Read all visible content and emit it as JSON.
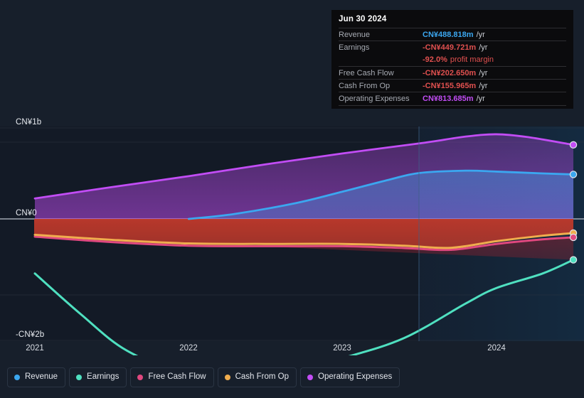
{
  "chart_data": {
    "type": "area",
    "title": "",
    "xlabel": "",
    "ylabel": "",
    "currency": "CN¥",
    "ylim": [
      -2400000000,
      1200000000
    ],
    "y_ticks": [
      {
        "label": "CN¥1b",
        "value": 1000000000
      },
      {
        "label": "CN¥0",
        "value": 0
      },
      {
        "label": "-CN¥2b",
        "value": -2000000000
      }
    ],
    "x_ticks": [
      "2021",
      "2022",
      "2023",
      "2024"
    ],
    "grid": true,
    "legend_position": "bottom",
    "forecast_divider_year": 2023.5,
    "series": [
      {
        "name": "Revenue",
        "color": "#3ba7f0",
        "points": [
          {
            "x": 2022.0,
            "y": 0
          },
          {
            "x": 2022.3,
            "y": 55000000
          },
          {
            "x": 2022.7,
            "y": 175000000
          },
          {
            "x": 2023.0,
            "y": 300000000
          },
          {
            "x": 2023.3,
            "y": 430000000
          },
          {
            "x": 2023.5,
            "y": 505000000
          },
          {
            "x": 2023.8,
            "y": 530000000
          },
          {
            "x": 2024.0,
            "y": 520000000
          },
          {
            "x": 2024.3,
            "y": 500000000
          },
          {
            "x": 2024.5,
            "y": 488818000
          }
        ]
      },
      {
        "name": "Earnings",
        "color": "#4fe0c0",
        "points": [
          {
            "x": 2021.0,
            "y": -600000000
          },
          {
            "x": 2021.3,
            "y": -1050000000
          },
          {
            "x": 2021.6,
            "y": -1450000000
          },
          {
            "x": 2022.0,
            "y": -1720000000
          },
          {
            "x": 2022.3,
            "y": -1760000000
          },
          {
            "x": 2022.6,
            "y": -1700000000
          },
          {
            "x": 2023.0,
            "y": -1530000000
          },
          {
            "x": 2023.4,
            "y": -1310000000
          },
          {
            "x": 2023.8,
            "y": -930000000
          },
          {
            "x": 2024.0,
            "y": -760000000
          },
          {
            "x": 2024.3,
            "y": -600000000
          },
          {
            "x": 2024.5,
            "y": -449721000
          }
        ]
      },
      {
        "name": "Free Cash Flow",
        "color": "#e0487f",
        "points": [
          {
            "x": 2021.0,
            "y": -195000000
          },
          {
            "x": 2021.5,
            "y": -255000000
          },
          {
            "x": 2022.0,
            "y": -295000000
          },
          {
            "x": 2022.5,
            "y": -300000000
          },
          {
            "x": 2023.0,
            "y": -300000000
          },
          {
            "x": 2023.4,
            "y": -320000000
          },
          {
            "x": 2023.7,
            "y": -340000000
          },
          {
            "x": 2024.0,
            "y": -275000000
          },
          {
            "x": 2024.3,
            "y": -225000000
          },
          {
            "x": 2024.5,
            "y": -202650000
          }
        ]
      },
      {
        "name": "Cash From Op",
        "color": "#f0ad4e",
        "points": [
          {
            "x": 2021.0,
            "y": -175000000
          },
          {
            "x": 2021.5,
            "y": -230000000
          },
          {
            "x": 2022.0,
            "y": -270000000
          },
          {
            "x": 2022.5,
            "y": -275000000
          },
          {
            "x": 2023.0,
            "y": -275000000
          },
          {
            "x": 2023.4,
            "y": -295000000
          },
          {
            "x": 2023.7,
            "y": -318000000
          },
          {
            "x": 2024.0,
            "y": -245000000
          },
          {
            "x": 2024.3,
            "y": -185000000
          },
          {
            "x": 2024.5,
            "y": -155965000
          }
        ]
      },
      {
        "name": "Operating Expenses",
        "color": "#c24df5",
        "points": [
          {
            "x": 2021.0,
            "y": 225000000
          },
          {
            "x": 2021.5,
            "y": 350000000
          },
          {
            "x": 2022.0,
            "y": 470000000
          },
          {
            "x": 2022.5,
            "y": 600000000
          },
          {
            "x": 2023.0,
            "y": 720000000
          },
          {
            "x": 2023.5,
            "y": 830000000
          },
          {
            "x": 2023.8,
            "y": 905000000
          },
          {
            "x": 2024.0,
            "y": 930000000
          },
          {
            "x": 2024.2,
            "y": 900000000
          },
          {
            "x": 2024.5,
            "y": 813685000
          }
        ]
      }
    ]
  },
  "tooltip": {
    "title": "Jun 30 2024",
    "rows": [
      {
        "key": "Revenue",
        "value": "CN¥488.818m",
        "unit": "/yr",
        "color": "#3ba7f0"
      },
      {
        "key": "Earnings",
        "value": "-CN¥449.721m",
        "unit": "/yr",
        "color": "#e0504f"
      },
      {
        "key": "",
        "value": "-92.0%",
        "unit": "",
        "sub": "profit margin",
        "color": "#e0504f"
      },
      {
        "key": "Free Cash Flow",
        "value": "-CN¥202.650m",
        "unit": "/yr",
        "color": "#e0504f"
      },
      {
        "key": "Cash From Op",
        "value": "-CN¥155.965m",
        "unit": "/yr",
        "color": "#e0504f"
      },
      {
        "key": "Operating Expenses",
        "value": "CN¥813.685m",
        "unit": "/yr",
        "color": "#c24df5"
      }
    ]
  },
  "legend": {
    "items": [
      {
        "label": "Revenue",
        "color": "#3ba7f0"
      },
      {
        "label": "Earnings",
        "color": "#4fe0c0"
      },
      {
        "label": "Free Cash Flow",
        "color": "#e0487f"
      },
      {
        "label": "Cash From Op",
        "color": "#f0ad4e"
      },
      {
        "label": "Operating Expenses",
        "color": "#c24df5"
      }
    ]
  },
  "axis": {
    "y_labels": [
      "CN¥1b",
      "CN¥0",
      "-CN¥2b"
    ],
    "x_labels": [
      "2021",
      "2022",
      "2023",
      "2024"
    ]
  }
}
